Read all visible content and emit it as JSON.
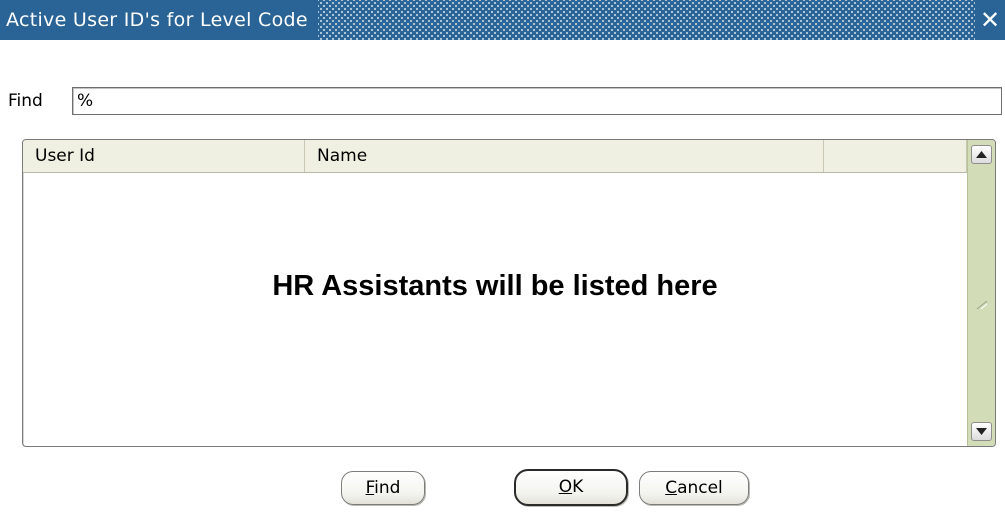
{
  "window": {
    "title": "Active User ID's for Level Code",
    "close_glyph": "✕",
    "titlebar_color": "#2a6496"
  },
  "search": {
    "label": "Find",
    "value": "%"
  },
  "table": {
    "columns": [
      "User Id",
      "Name",
      ""
    ],
    "rows": [],
    "placeholder": "HR Assistants will be listed here"
  },
  "scrollbar": {
    "up_icon": "arrow-up-icon",
    "down_icon": "arrow-down-icon",
    "grip_icon": "grip-icon"
  },
  "buttons": {
    "find": {
      "mnemonic": "F",
      "rest": "ind"
    },
    "ok": {
      "mnemonic": "O",
      "rest": "K",
      "default": true
    },
    "cancel": {
      "mnemonic": "C",
      "rest": "ancel"
    }
  }
}
